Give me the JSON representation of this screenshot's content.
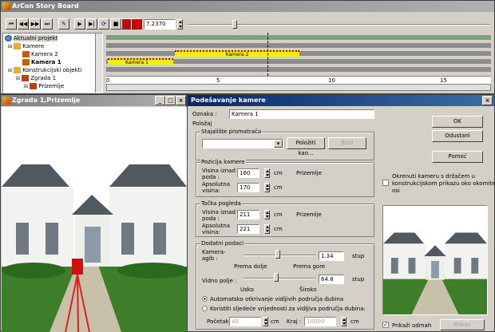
{
  "story_board": {
    "title": "ArCon Story Board",
    "time_value": "7.2370",
    "tree": [
      {
        "label": "Aktualni projekt",
        "bold": false
      },
      {
        "label": "Kamere",
        "bold": false
      },
      {
        "label": "Kamera 2",
        "bold": false
      },
      {
        "label": "Kamera 1",
        "bold": true
      },
      {
        "label": "Konstrukcijski objekti",
        "bold": false
      },
      {
        "label": "Zgrada 1",
        "bold": false
      },
      {
        "label": "Prizemlje",
        "bold": false
      }
    ],
    "clip_kamera2": "Kamera 2",
    "clip_kamera1": "Kamera 1",
    "ruler": [
      "0",
      "5",
      "10",
      "15"
    ]
  },
  "viewport": {
    "title": "Zgrada 1,Prizemlje",
    "controls": [
      "_",
      "□",
      "×"
    ]
  },
  "dialog": {
    "title": "Podešavanje kamere",
    "oznaka_label": "Oznaka :",
    "oznaka_value": "Kamera 1",
    "polozaj_label": "Položaj",
    "stajaliste_label": "Stajalište promatrača",
    "polozi_kao_label": "Položiti kao...",
    "brisi_label": "Briši",
    "pozicija_label": "Pozicija kamere",
    "visina_poda_label1": "Visina iznad",
    "visina_poda_label2": "poda :",
    "visina_poda_value": "160",
    "apsolutna_label1": "Apsolutna",
    "apsolutna_label2": "visina:",
    "apsolutna_value": "170",
    "unit_cm": "cm",
    "prizemlje": "Prizemlje",
    "tocka_label": "Točka pogleda",
    "tocka_visina_value": "211",
    "tocka_apsolutna_value": "221",
    "dodatni_label": "Dodatni podaci",
    "kamera_agib_label1": "Kamera-",
    "kamera_agib_label2": "agib :",
    "agib_value": "1.34",
    "stup": "stup",
    "prema_dolje": "Prema dolje",
    "prema_gore": "Prema gore",
    "vidno_polje_label": "Vidno polje :",
    "vidno_value": "64.8",
    "usko": "Usko",
    "siroko": "Široko",
    "radio_auto": "Automatsko otkrivanje vidljivih područja dubina",
    "radio_manual": "Koristiti sljedeće vrijednosti za vidljiva područja dubina:",
    "pocetak_label": "Početak",
    "pocetak_value": "40",
    "kraj_label": "Kraj :",
    "kraj_value": "10000",
    "ok": "OK",
    "odustani": "Odustani",
    "pomoc": "Pomoć",
    "okrenuti_text1": "Okrenuti kameru s držačem u",
    "okrenuti_text2": "konstrukcijskom prikazu oko okomite",
    "okrenuti_text3": "osi",
    "prikazi_odmah": "Prikaži odmah",
    "prikaz": "Prikaz",
    "close": "×"
  }
}
